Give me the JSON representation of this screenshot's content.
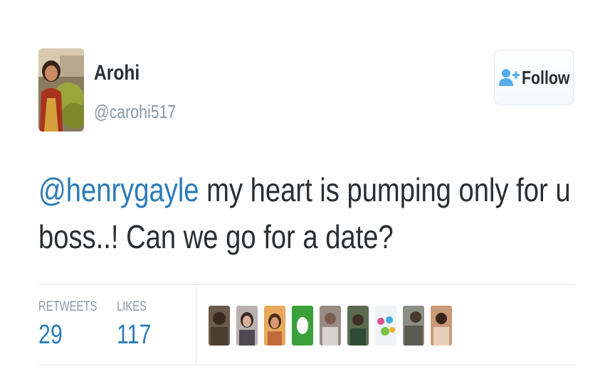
{
  "user": {
    "name": "Arohi",
    "handle": "@carohi517"
  },
  "follow_button": {
    "label": "Follow",
    "icon": "add-user-icon"
  },
  "tweet": {
    "mention": "@henrygayle",
    "text_line1_rest": " my heart is pumping only for u",
    "text_line2": "boss..! Can we go for a date?"
  },
  "stats": {
    "retweets_label": "RETWEETS",
    "retweets_count": "29",
    "likes_label": "LIKES",
    "likes_count": "117"
  },
  "likers": [
    {
      "name": "liker-avatar-1"
    },
    {
      "name": "liker-avatar-2"
    },
    {
      "name": "liker-avatar-3"
    },
    {
      "name": "liker-avatar-4"
    },
    {
      "name": "liker-avatar-5"
    },
    {
      "name": "liker-avatar-6"
    },
    {
      "name": "liker-avatar-7"
    },
    {
      "name": "liker-avatar-8"
    },
    {
      "name": "liker-avatar-9"
    }
  ],
  "colors": {
    "link": "#2b7bb9",
    "text": "#292f33",
    "muted": "#8899a6",
    "border": "#e1e8ed"
  }
}
